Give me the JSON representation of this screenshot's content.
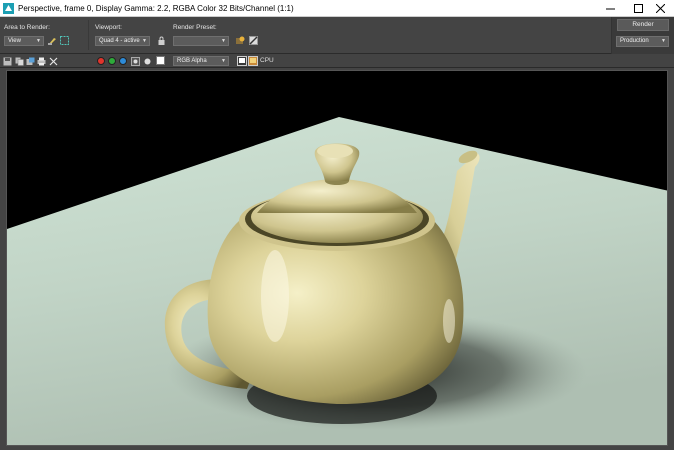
{
  "window": {
    "title": "Perspective, frame 0, Display Gamma: 2.2, RGBA Color 32 Bits/Channel (1:1)"
  },
  "toolbar": {
    "area_label": "Area to Render:",
    "area_value": "View",
    "viewport_label": "Viewport:",
    "viewport_value": "Quad 4 - active",
    "preset_label": "Render Preset:",
    "preset_value": "",
    "render_label": "Render",
    "production_value": "Production"
  },
  "toolbar2": {
    "channel_value": "RGB Alpha",
    "cpu_label": "CPU"
  },
  "colors": {
    "red_channel": "#e0342c",
    "green_channel": "#2eaa3a",
    "blue_channel": "#2d8bd8"
  }
}
